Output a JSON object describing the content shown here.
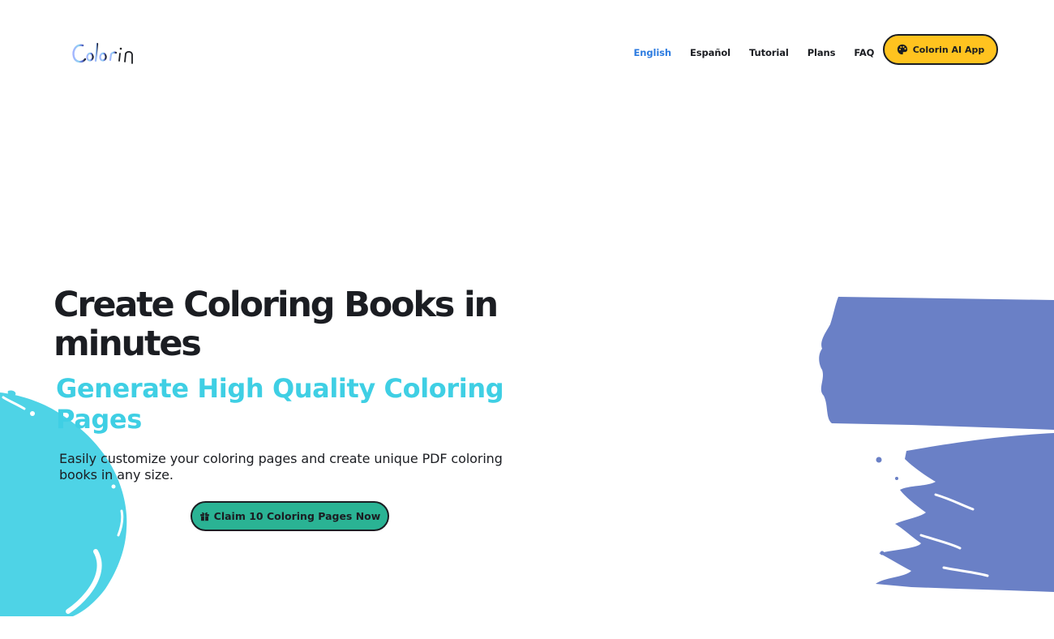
{
  "brand": {
    "name": "Colorin"
  },
  "nav": {
    "items": [
      {
        "label": "English",
        "active": true
      },
      {
        "label": "Español",
        "active": false
      },
      {
        "label": "Tutorial",
        "active": false
      },
      {
        "label": "Plans",
        "active": false
      },
      {
        "label": "FAQ",
        "active": false
      }
    ],
    "app_button": {
      "label": "Colorin AI App",
      "icon": "palette-icon"
    }
  },
  "hero": {
    "title": "Create Coloring Books in minutes",
    "subtitle": "Generate High Quality Coloring Pages",
    "description": "Easily customize your coloring pages and create unique PDF coloring books in any size.",
    "cta": {
      "label": "Claim 10 Coloring Pages Now",
      "icon": "gift-icon"
    }
  },
  "colors": {
    "accent_blue": "#2c7be0",
    "app_button_bg": "#ffc31f",
    "cta_bg": "#2ab394",
    "subtitle": "#3fcfe4",
    "splash_cyan": "#4ed3e6",
    "paint_blue": "#6a80c6"
  }
}
